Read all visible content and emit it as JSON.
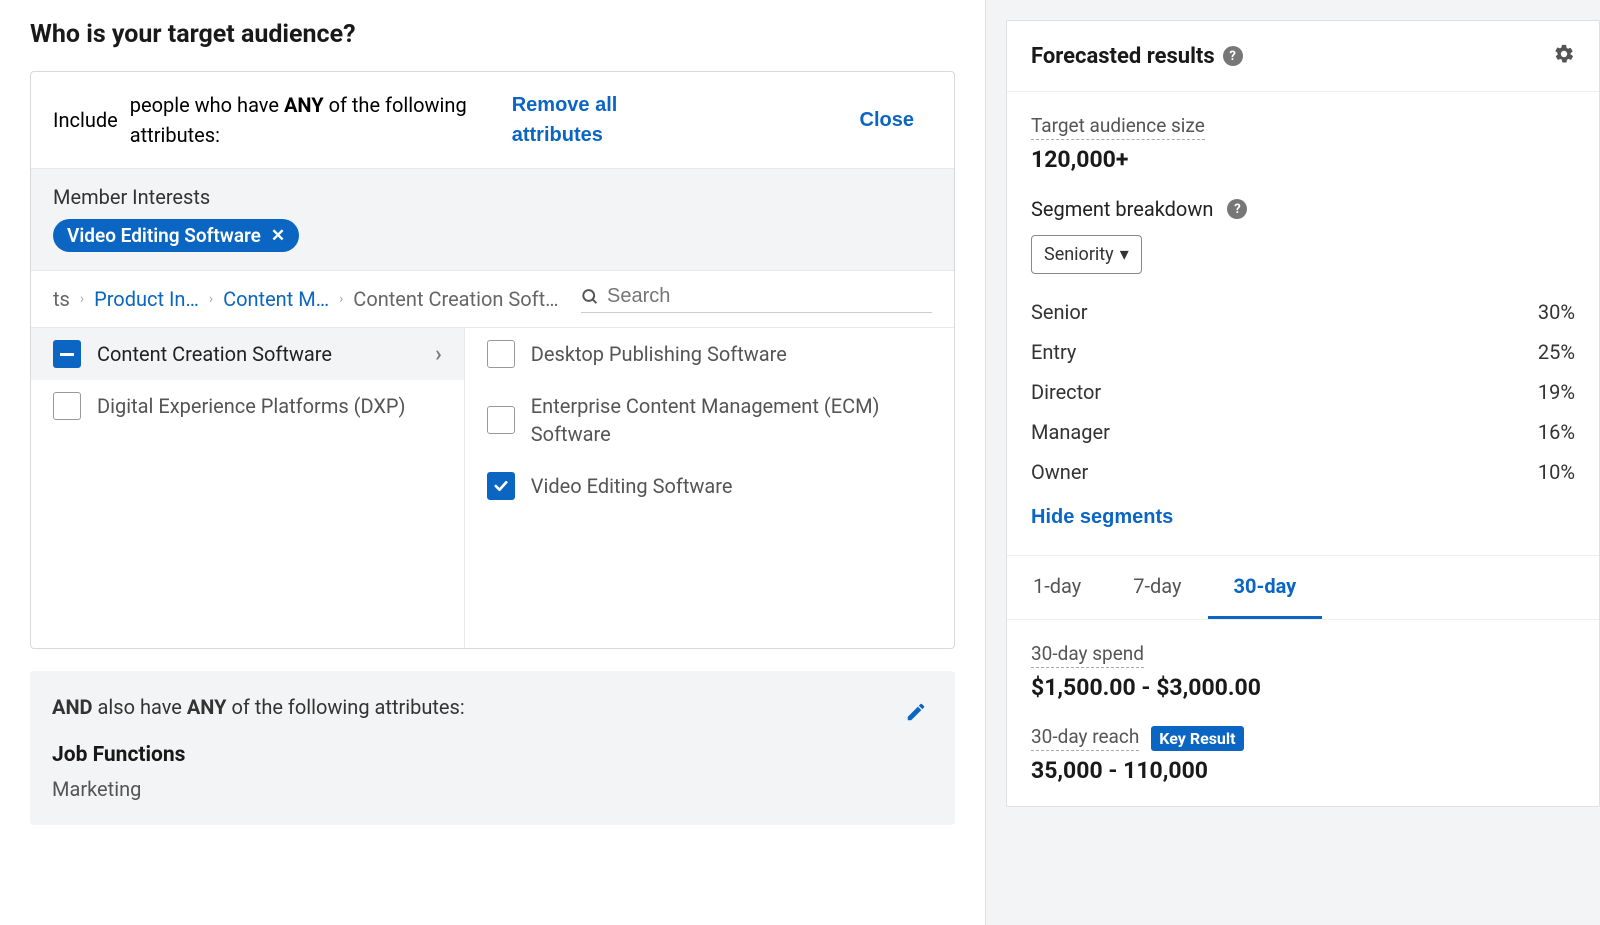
{
  "heading": "Who is your target audience?",
  "include": {
    "label": "Include",
    "desc_prefix": "people who have ",
    "desc_bold": "ANY",
    "desc_suffix": " of the following attributes:",
    "remove": "Remove all attributes",
    "close": "Close"
  },
  "interests": {
    "title": "Member Interests",
    "pill": "Video Editing Software"
  },
  "breadcrumb": {
    "c0": "ts",
    "c1": "Product In…",
    "c2": "Content M…",
    "c3": "Content Creation Soft…",
    "search_placeholder": "Search"
  },
  "left_options": {
    "o0": "Content Creation Software",
    "o1": "Digital Experience Platforms (DXP)"
  },
  "right_options": {
    "r0": "Desktop Publishing Software",
    "r1": "Enterprise Content Management (ECM) Software",
    "r2": "Video Editing Software"
  },
  "and_block": {
    "prefix": "AND",
    "mid": " also have ",
    "bold": "ANY",
    "suffix": " of the following attributes:",
    "job_title": "Job Functions",
    "job_value": "Marketing"
  },
  "forecast": {
    "title": "Forecasted results",
    "target_label": "Target audience size",
    "target_value": "120,000+",
    "segment_title": "Segment breakdown",
    "dropdown": "Seniority",
    "rows": {
      "r0l": "Senior",
      "r0v": "30%",
      "r1l": "Entry",
      "r1v": "25%",
      "r2l": "Director",
      "r2v": "19%",
      "r3l": "Manager",
      "r3v": "16%",
      "r4l": "Owner",
      "r4v": "10%"
    },
    "hide": "Hide segments",
    "tabs": {
      "t0": "1-day",
      "t1": "7-day",
      "t2": "30-day"
    },
    "spend_label": "30-day spend",
    "spend_value": "$1,500.00 - $3,000.00",
    "reach_label": "30-day reach",
    "key_result": "Key Result",
    "reach_value": "35,000 - 110,000"
  }
}
